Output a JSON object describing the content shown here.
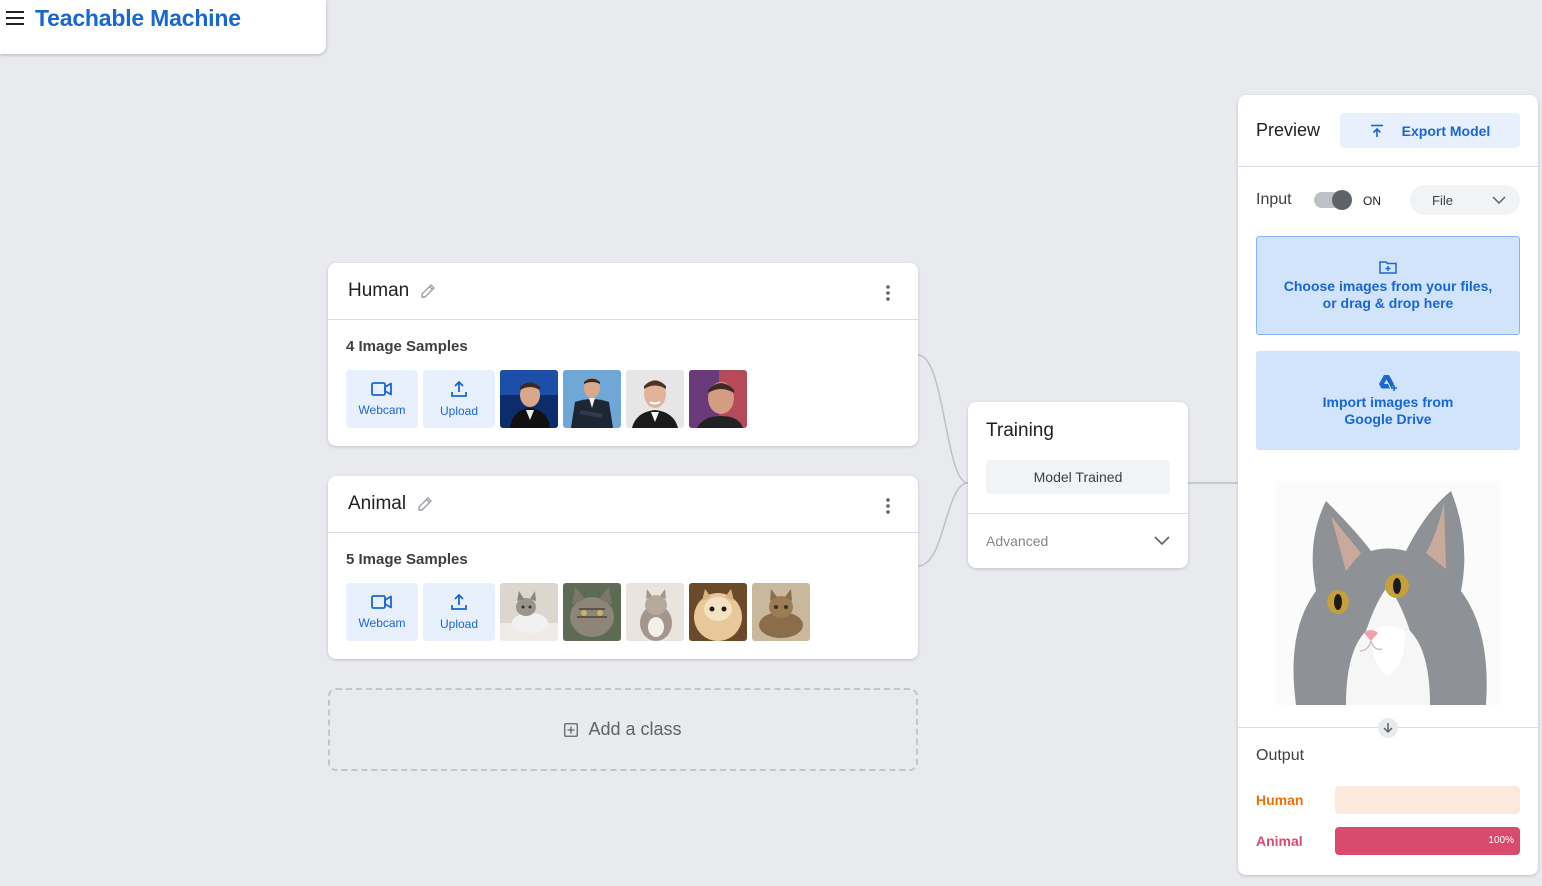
{
  "app": {
    "title": "Teachable Machine"
  },
  "classes": [
    {
      "name": "Human",
      "samples_label": "4 Image Samples",
      "webcam_label": "Webcam",
      "upload_label": "Upload",
      "thumbnails": [
        "person-photo",
        "person-photo",
        "person-photo",
        "person-photo"
      ]
    },
    {
      "name": "Animal",
      "samples_label": "5 Image Samples",
      "webcam_label": "Webcam",
      "upload_label": "Upload",
      "thumbnails": [
        "cat-photo",
        "cat-photo",
        "cat-photo",
        "cat-photo",
        "cat-photo"
      ]
    }
  ],
  "add_class_label": "Add a class",
  "training": {
    "title": "Training",
    "button_label": "Model Trained",
    "advanced_label": "Advanced"
  },
  "preview": {
    "title": "Preview",
    "export_label": "Export Model",
    "input_label": "Input",
    "toggle_state": "ON",
    "source_selected": "File",
    "drop_zone_line1": "Choose images from your files,",
    "drop_zone_line2": "or drag & drop here",
    "drive_line1": "Import images from",
    "drive_line2": "Google Drive",
    "output_label": "Output",
    "outputs": [
      {
        "name": "Human",
        "value": 0,
        "pct_label": "",
        "color": "#e8710a",
        "track": "#fde9dc"
      },
      {
        "name": "Animal",
        "value": 1.0,
        "pct_label": "100%",
        "color": "#d94a6f",
        "track": "#fde0e6"
      }
    ]
  },
  "colors": {
    "accent": "#1967d2",
    "background": "#e8eaed"
  }
}
